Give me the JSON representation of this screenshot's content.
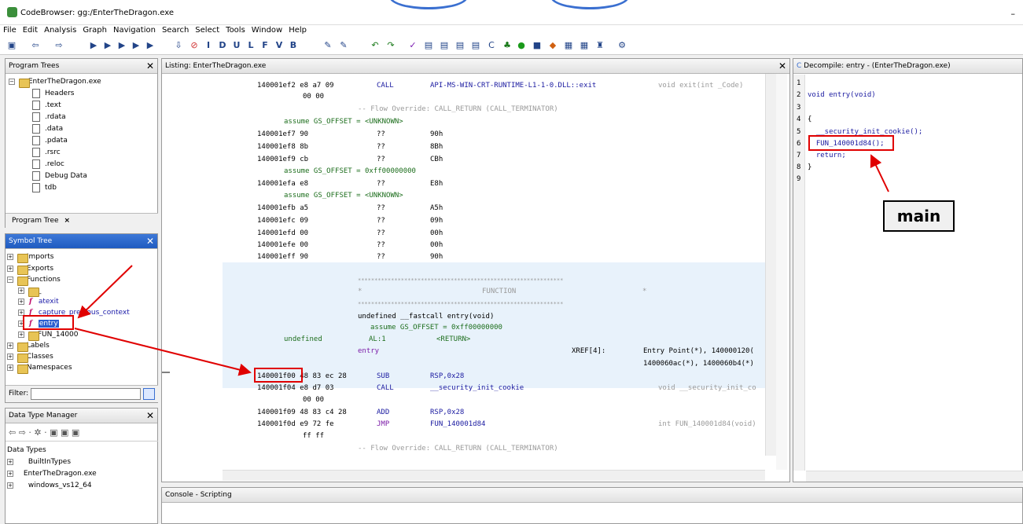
{
  "window": {
    "title": "CodeBrowser: gg:/EnterTheDragon.exe",
    "minimize": "–"
  },
  "menu": [
    "File",
    "Edit",
    "Analysis",
    "Graph",
    "Navigation",
    "Search",
    "Select",
    "Tools",
    "Window",
    "Help"
  ],
  "program_trees": {
    "title": "Program Trees",
    "root": "EnterTheDragon.exe",
    "children": [
      "Headers",
      ".text",
      ".rdata",
      ".data",
      ".pdata",
      ".rsrc",
      ".reloc",
      "Debug Data",
      "tdb"
    ],
    "tab": "Program Tree",
    "tab_close": "×"
  },
  "symbol_tree": {
    "title": "Symbol Tree",
    "items": [
      "Imports",
      "Exports",
      "Functions",
      "_",
      "atexit",
      "capture_previous_context",
      "entry",
      "FUN_14000",
      "Labels",
      "Classes",
      "Namespaces"
    ],
    "filter_label": "Filter:"
  },
  "datatype_manager": {
    "title": "Data Type Manager",
    "items": [
      "Data Types",
      "BuiltInTypes",
      "EnterTheDragon.exe",
      "windows_vs12_64"
    ]
  },
  "listing": {
    "title": "Listing:  EnterTheDragon.exe",
    "rows": [
      {
        "addr": "140001ef2",
        "bytes": "e8 a7 09",
        "mnem": "CALL",
        "oper": "API-MS-WIN-CRT-RUNTIME-L1-1-0.DLL::exit",
        "cmt": "void exit(int _Code)"
      },
      {
        "bytes2": "00 00"
      },
      {
        "override": "-- Flow Override: CALL_RETURN (CALL_TERMINATOR)"
      },
      {
        "assume": "assume GS_OFFSET = <UNKNOWN>"
      },
      {
        "addr": "140001ef7",
        "bytes": "90",
        "mnem": "??",
        "oper": "90h"
      },
      {
        "addr": "140001ef8",
        "bytes": "8b",
        "mnem": "??",
        "oper": "8Bh"
      },
      {
        "addr": "140001ef9",
        "bytes": "cb",
        "mnem": "??",
        "oper": "CBh"
      },
      {
        "assume": "assume GS_OFFSET = 0xff00000000"
      },
      {
        "addr": "140001efa",
        "bytes": "e8",
        "mnem": "??",
        "oper": "E8h"
      },
      {
        "assume": "assume GS_OFFSET = <UNKNOWN>"
      },
      {
        "addr": "140001efb",
        "bytes": "a5",
        "mnem": "??",
        "oper": "A5h"
      },
      {
        "addr": "140001efc",
        "bytes": "09",
        "mnem": "??",
        "oper": "09h"
      },
      {
        "addr": "140001efd",
        "bytes": "00",
        "mnem": "??",
        "oper": "00h"
      },
      {
        "addr": "140001efe",
        "bytes": "00",
        "mnem": "??",
        "oper": "00h"
      },
      {
        "addr": "140001eff",
        "bytes": "90",
        "mnem": "??",
        "oper": "90h"
      }
    ],
    "stars": "**************************************************************",
    "star_side": "*",
    "function_label": "FUNCTION",
    "signature": "undefined __fastcall entry(void)",
    "signature_assume": "assume GS_OFFSET = 0xff00000000",
    "ret_type": "undefined",
    "ret_reg": "AL:1",
    "ret_tag": "<RETURN>",
    "label": "entry",
    "xref": "XREF[4]:",
    "xref1": "Entry Point(*), 140000120(",
    "xref2": "1400060ac(*), 1400060b4(*)",
    "rows2": [
      {
        "addr": "140001f00",
        "bytes": "48 83 ec 28",
        "mnem": "SUB",
        "oper": "RSP,0x28"
      },
      {
        "addr": "140001f04",
        "bytes": "e8 d7 03",
        "mnem": "CALL",
        "oper": "__security_init_cookie",
        "cmt": "void __security_init_co"
      },
      {
        "bytes2": "00 00"
      },
      {
        "addr": "140001f09",
        "bytes": "48 83 c4 28",
        "mnem": "ADD",
        "oper": "RSP,0x28"
      },
      {
        "addr": "140001f0d",
        "bytes": "e9 72 fe",
        "mnem": "JMP",
        "oper": "FUN_140001d84",
        "cmt": "int FUN_140001d84(void)"
      },
      {
        "bytes2": "ff ff"
      },
      {
        "override": "-- Flow Override: CALL_RETURN (CALL_TERMINATOR)"
      }
    ]
  },
  "decompile": {
    "title": "Decompile: entry -  (EnterTheDragon.exe)",
    "lines": [
      {
        "n": "1",
        "t": ""
      },
      {
        "n": "2",
        "t": "void entry(void)"
      },
      {
        "n": "3",
        "t": ""
      },
      {
        "n": "4",
        "t": "{"
      },
      {
        "n": "5",
        "t": "  __security_init_cookie();"
      },
      {
        "n": "6",
        "t": "  FUN_140001d84();"
      },
      {
        "n": "7",
        "t": "  return;"
      },
      {
        "n": "8",
        "t": "}"
      },
      {
        "n": "9",
        "t": ""
      }
    ]
  },
  "console": {
    "title": "Console - Scripting"
  },
  "annotation": {
    "label": "main",
    "color": "#e00000"
  }
}
